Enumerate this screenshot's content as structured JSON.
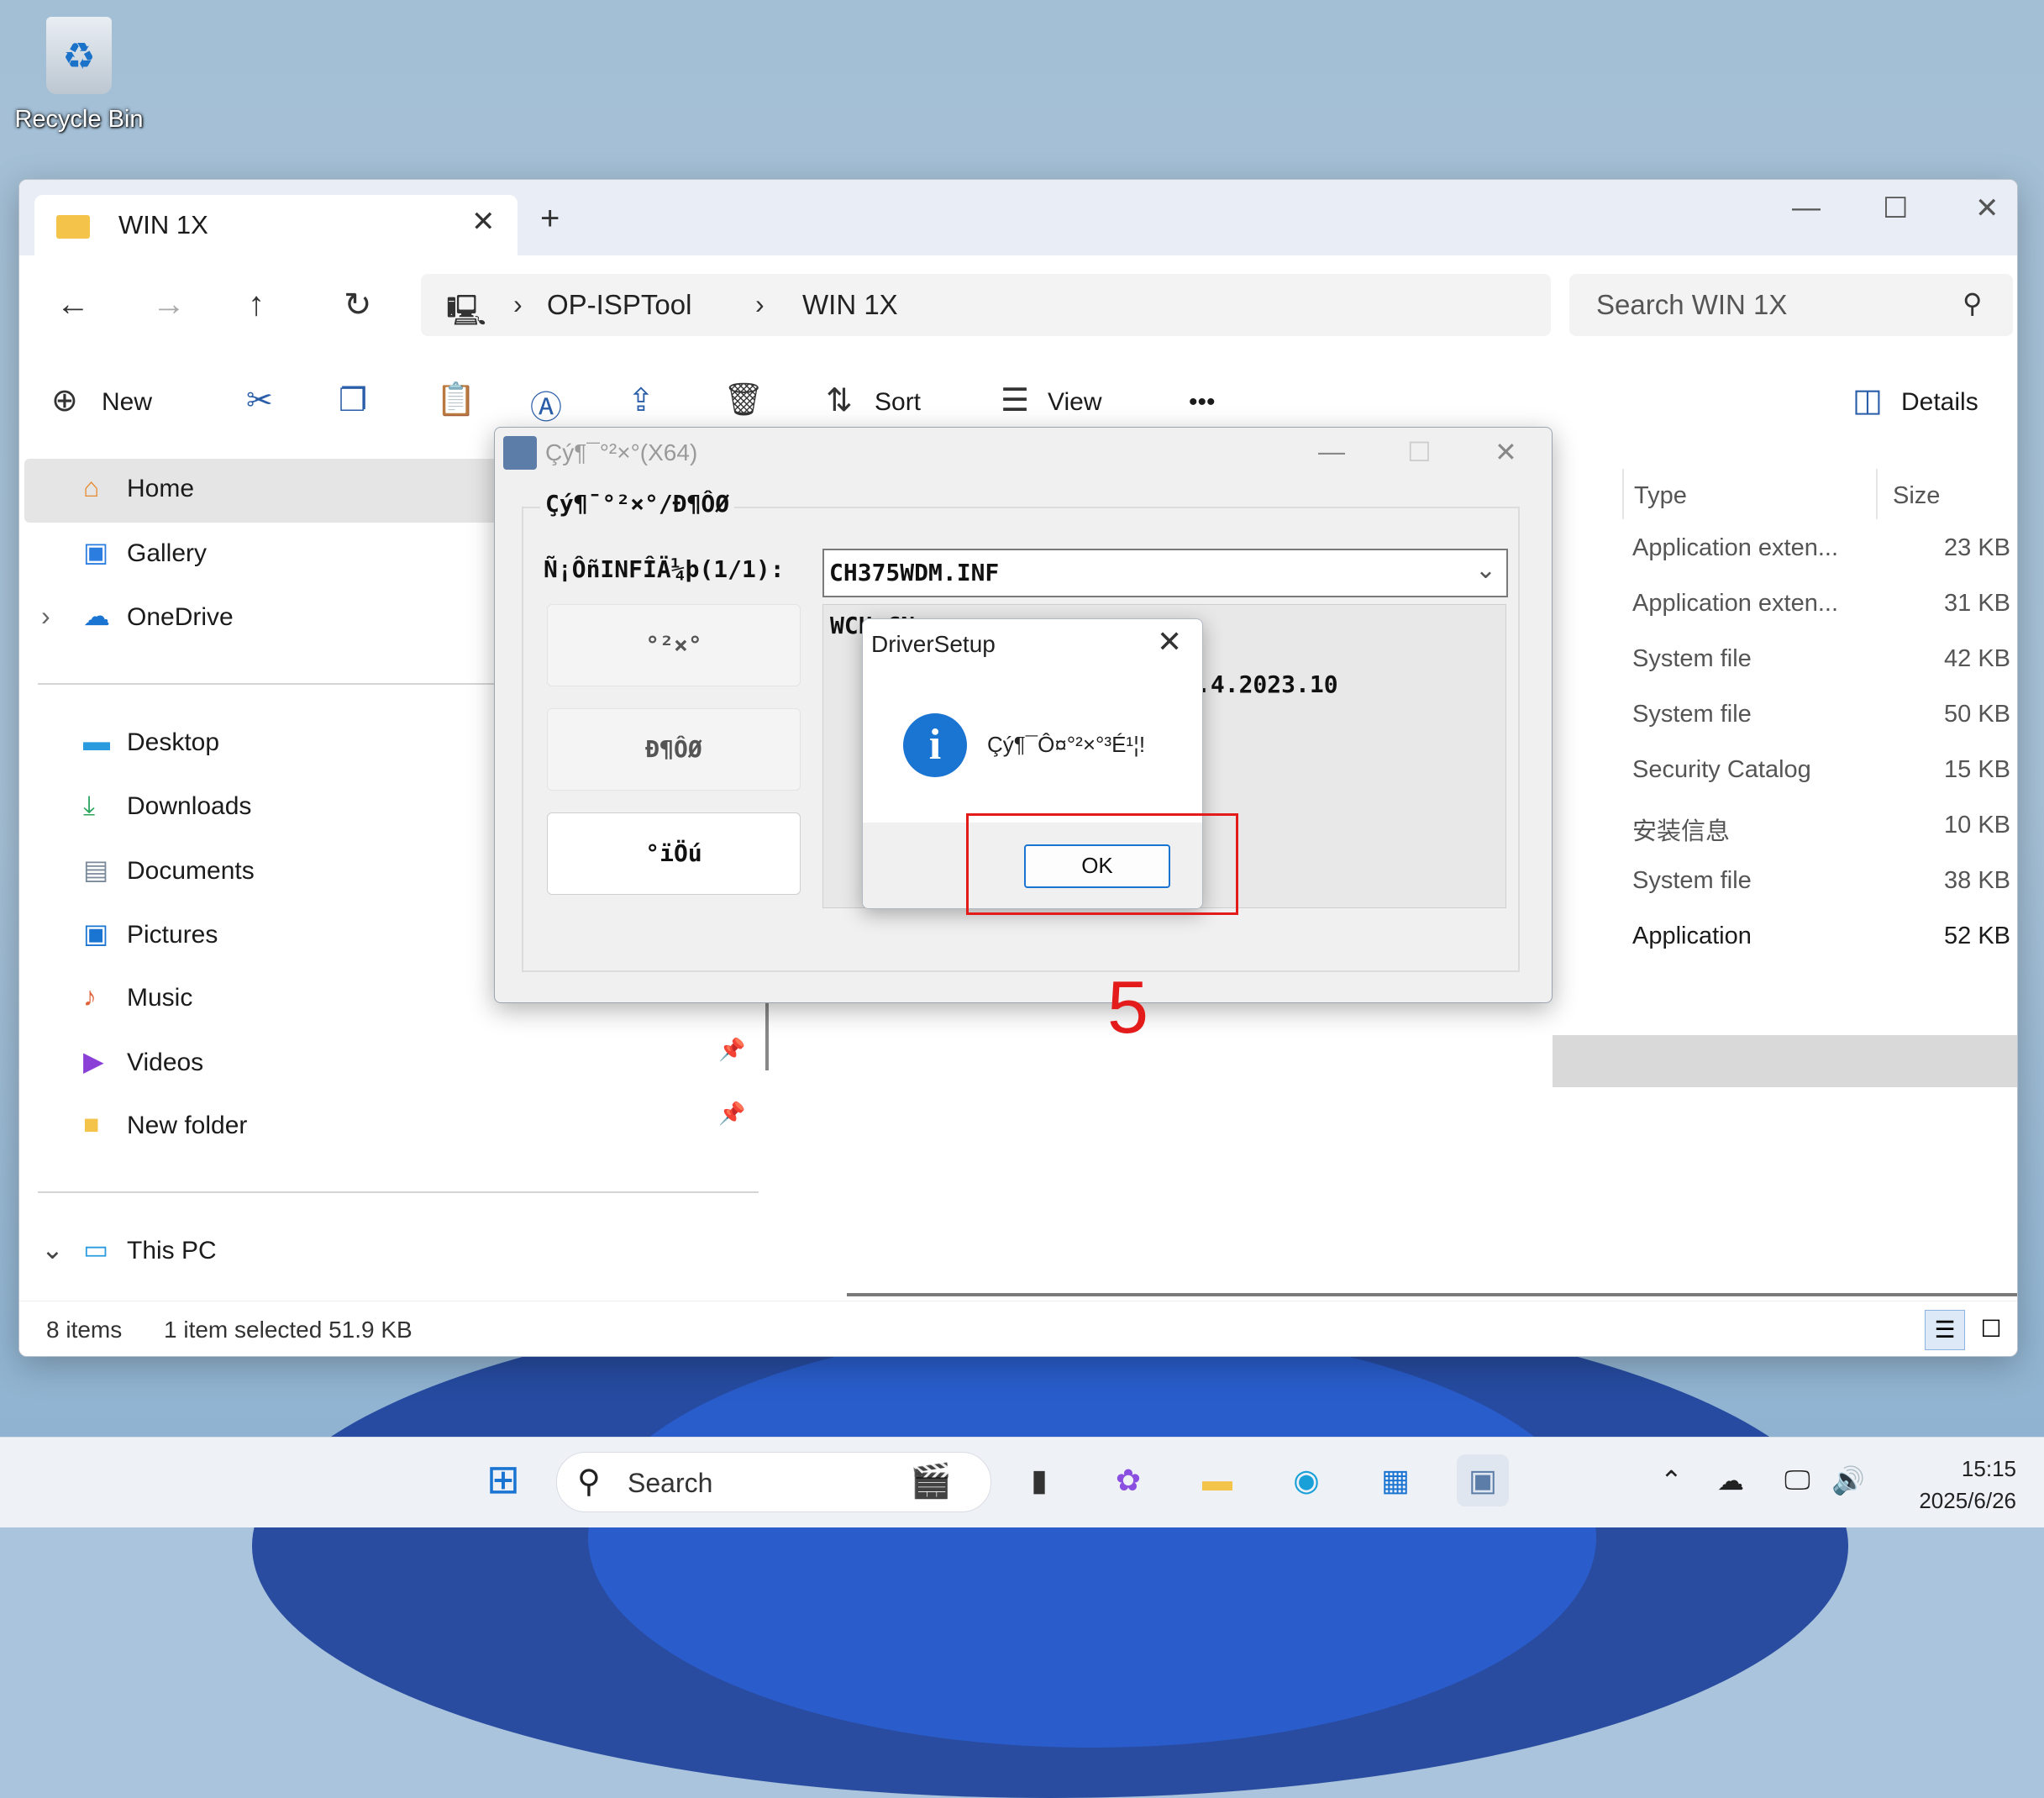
{
  "desktop": {
    "recycle_bin": "Recycle Bin"
  },
  "explorer": {
    "tab_title": "WIN 1X",
    "new_tab": "+",
    "breadcrumb": [
      "OP-ISPTool",
      "WIN 1X"
    ],
    "search_placeholder": "Search WIN 1X",
    "toolbar": {
      "new": "New",
      "sort": "Sort",
      "view": "View",
      "more": "•••",
      "details": "Details"
    },
    "nav": {
      "home": "Home",
      "gallery": "Gallery",
      "onedrive": "OneDrive",
      "desktop": "Desktop",
      "downloads": "Downloads",
      "documents": "Documents",
      "pictures": "Pictures",
      "music": "Music",
      "videos": "Videos",
      "new_folder": "New folder",
      "this_pc": "This PC"
    },
    "columns": {
      "type": "Type",
      "size": "Size"
    },
    "files": [
      {
        "type": "Application exten...",
        "size": "23 KB"
      },
      {
        "type": "Application exten...",
        "size": "31 KB"
      },
      {
        "type": "System file",
        "size": "42 KB"
      },
      {
        "type": "System file",
        "size": "50 KB"
      },
      {
        "type": "Security Catalog",
        "size": "15 KB"
      },
      {
        "type": "安装信息",
        "size": "10 KB"
      },
      {
        "type": "System file",
        "size": "38 KB"
      },
      {
        "type": "Application",
        "size": "52 KB"
      }
    ],
    "status": {
      "items": "8 items",
      "selected": "1 item selected  51.9 KB"
    }
  },
  "setup": {
    "title": "Çý¶¯°²×°(X64)",
    "group_legend": "Çý¶¯°²×°/Ð¶ÔØ",
    "inf_label": "Ñ¡ÔñINFÎÄ¼þ(1/1):",
    "inf_value": "CH375WDM.INF",
    "btn_install": "°²×°",
    "btn_uninstall": "Ð¶ÔØ",
    "btn_help": "°ïÖú",
    "info_line1": "WCH.CN",
    "info_line2": ".4.2023.10"
  },
  "msgbox": {
    "title": "DriverSetup",
    "message": "Çý¶¯Ô¤°²×°³É¹¦!",
    "ok": "OK"
  },
  "annotation": {
    "step": "5",
    "highlight_color": "#e31b1b"
  },
  "taskbar": {
    "search": "Search",
    "time": "15:15",
    "date": "2025/6/26"
  }
}
